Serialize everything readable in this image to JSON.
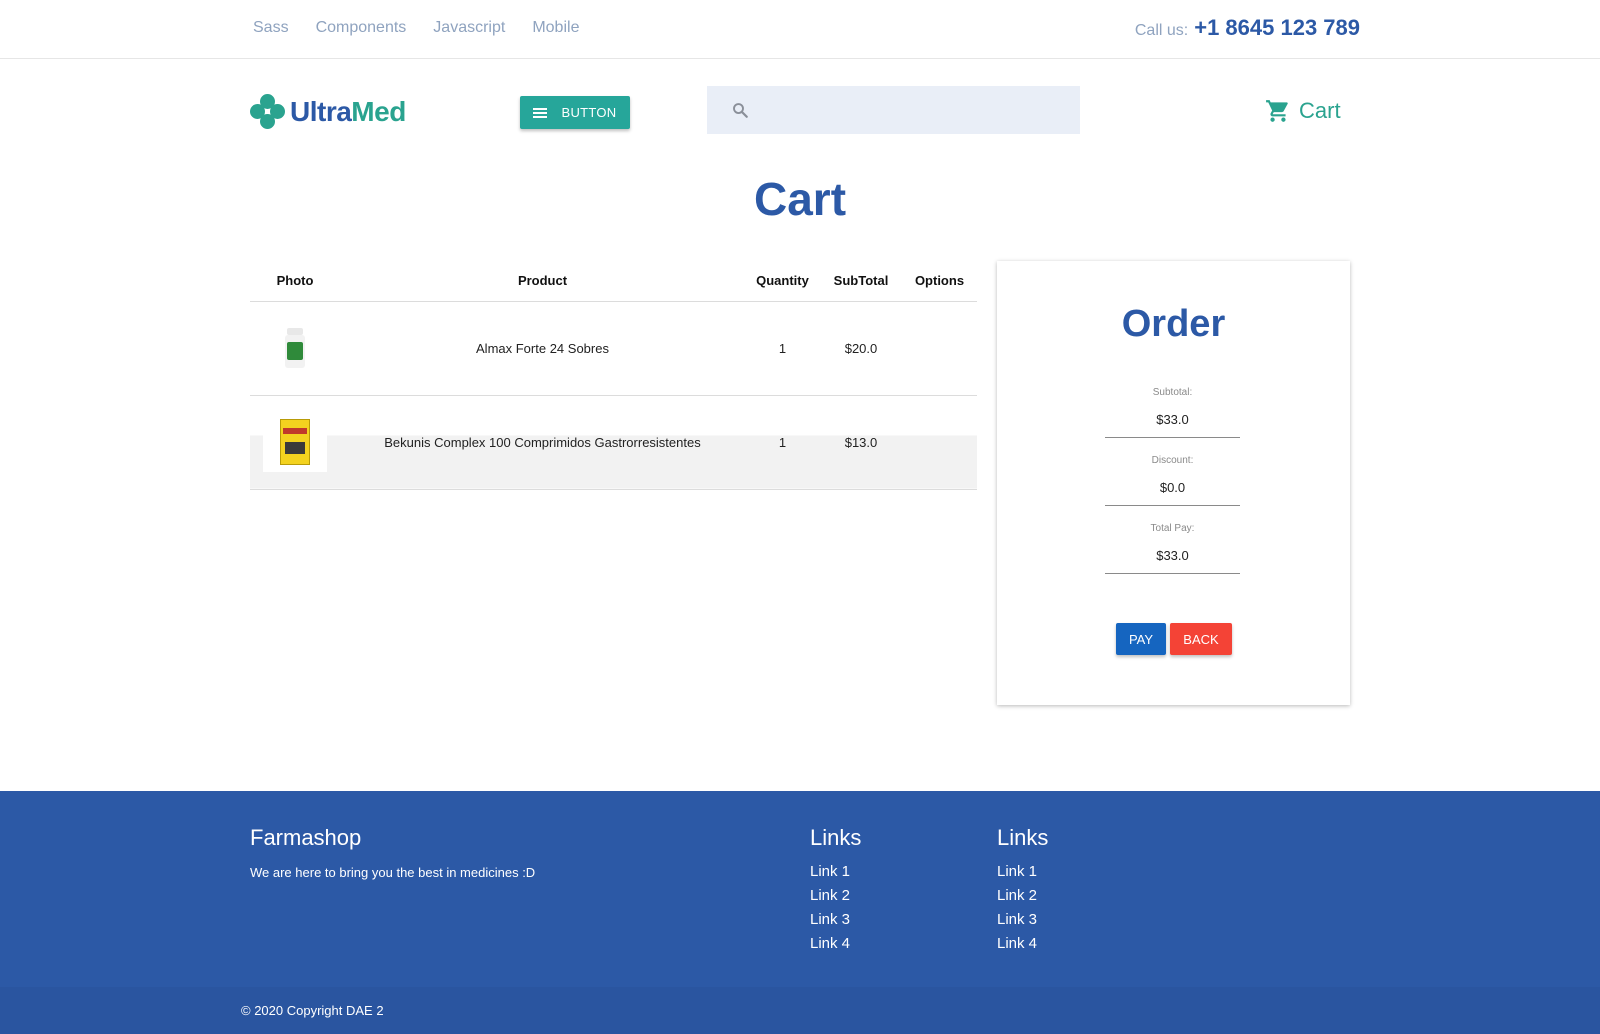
{
  "topbar": {
    "nav": [
      "Sass",
      "Components",
      "Javascript",
      "Mobile"
    ],
    "call_label": "Call us:",
    "call_number": "+1 8645 123 789"
  },
  "header": {
    "logo_part1": "Ultra",
    "logo_part2": "Med",
    "menu_button": "BUTTON",
    "search_placeholder": "",
    "cart_label": "Cart"
  },
  "page_title": "Cart",
  "table": {
    "headers": [
      "Photo",
      "Product",
      "Quantity",
      "SubTotal",
      "Options"
    ],
    "rows": [
      {
        "product": "Almax Forte 24 Sobres",
        "quantity": "1",
        "subtotal": "$20.0",
        "image": "bottle-icon"
      },
      {
        "product": "Bekunis Complex 100 Comprimidos Gastrorresistentes",
        "quantity": "1",
        "subtotal": "$13.0",
        "image": "box-icon"
      }
    ]
  },
  "order": {
    "title": "Order",
    "subtotal_label": "Subtotal:",
    "subtotal_value": "$33.0",
    "discount_label": "Discount:",
    "discount_value": "$0.0",
    "total_label": "Total Pay:",
    "total_value": "$33.0",
    "pay_button": "PAY",
    "back_button": "BACK"
  },
  "footer": {
    "brand": "Farmashop",
    "description": "We are here to bring you the best in medicines :D",
    "links_col1_title": "Links",
    "links_col1": [
      "Link 1",
      "Link 2",
      "Link 3",
      "Link 4"
    ],
    "links_col2_title": "Links",
    "links_col2": [
      "Link 1",
      "Link 2",
      "Link 3",
      "Link 4"
    ],
    "copyright": "© 2020 Copyright DAE 2"
  },
  "colors": {
    "primary": "#2c59a6",
    "teal": "#26a69a",
    "pay": "#1565c0",
    "back": "#f44336"
  }
}
